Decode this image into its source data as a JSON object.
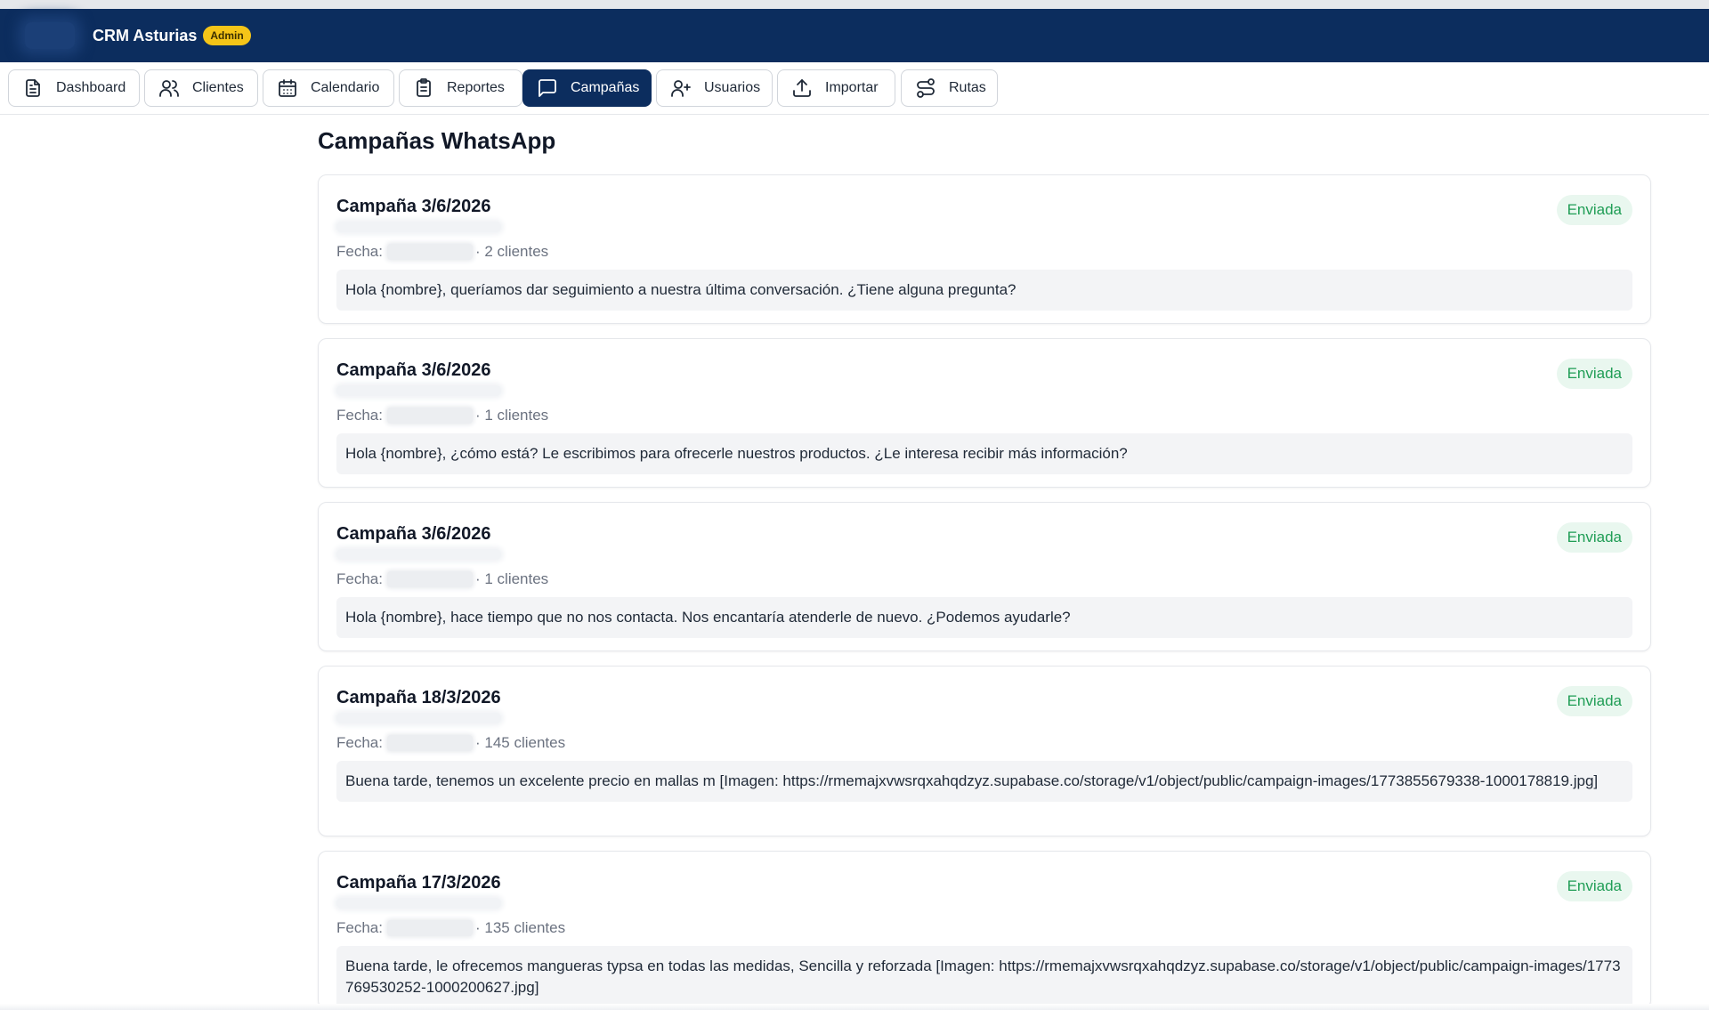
{
  "app": {
    "title": "CRM Asturias",
    "role_badge": "Admin"
  },
  "nav": [
    {
      "label": "Dashboard",
      "icon": "document-icon",
      "active": false
    },
    {
      "label": "Clientes",
      "icon": "users-icon",
      "active": false
    },
    {
      "label": "Calendario",
      "icon": "calendar-icon",
      "active": false
    },
    {
      "label": "Reportes",
      "icon": "clipboard-icon",
      "active": false
    },
    {
      "label": "Campañas",
      "icon": "message-square-icon",
      "active": true
    },
    {
      "label": "Usuarios",
      "icon": "user-plus-icon",
      "active": false
    },
    {
      "label": "Importar",
      "icon": "upload-icon",
      "active": false
    },
    {
      "label": "Rutas",
      "icon": "route-icon",
      "active": false
    }
  ],
  "page": {
    "title": "Campañas WhatsApp"
  },
  "campaigns": [
    {
      "title": "Campaña 3/6/2026",
      "status": "Enviada",
      "date_label": "Fecha:",
      "clients": "· 2 clientes",
      "message": "Hola {nombre}, queríamos dar seguimiento a nuestra última conversación. ¿Tiene alguna pregunta?"
    },
    {
      "title": "Campaña 3/6/2026",
      "status": "Enviada",
      "date_label": "Fecha:",
      "clients": "· 1 clientes",
      "message": "Hola {nombre}, ¿cómo está? Le escribimos para ofrecerle nuestros productos. ¿Le interesa recibir más información?"
    },
    {
      "title": "Campaña 3/6/2026",
      "status": "Enviada",
      "date_label": "Fecha:",
      "clients": "· 1 clientes",
      "message": "Hola {nombre}, hace tiempo que no nos contacta. Nos encantaría atenderle de nuevo. ¿Podemos ayudarle?"
    },
    {
      "title": "Campaña 18/3/2026",
      "status": "Enviada",
      "date_label": "Fecha:",
      "clients": "· 145 clientes",
      "message": "Buena tarde, tenemos un excelente precio en mallas m [Imagen: https://rmemajxvwsrqxahqdzyz.supabase.co/storage/v1/object/public/campaign-images/1773855679338-1000178819.jpg]"
    },
    {
      "title": "Campaña 17/3/2026",
      "status": "Enviada",
      "date_label": "Fecha:",
      "clients": "· 135 clientes",
      "message": "Buena tarde, le ofrecemos mangueras typsa en todas las medidas, Sencilla y reforzada [Imagen: https://rmemajxvwsrqxahqdzyz.supabase.co/storage/v1/object/public/campaign-images/1773769530252-1000200627.jpg]"
    }
  ],
  "colors": {
    "appbar": "#0c2d5e",
    "badge": "#f5c518",
    "status_text": "#1f9d55",
    "status_bg": "#e9f7ef"
  }
}
